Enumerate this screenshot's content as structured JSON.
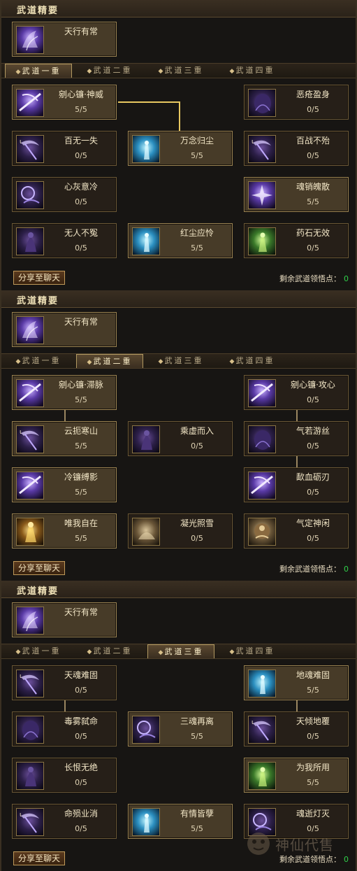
{
  "colors": {
    "accent_gold": "#e8c860",
    "points_green": "#2fd04a",
    "frame": "#6b5836"
  },
  "panels": [
    {
      "section_title": "武道精要",
      "essential": {
        "name": "天行有常",
        "icon": "ghost-dancer-icon"
      },
      "tabs": [
        "武道一重",
        "武道二重",
        "武道三重",
        "武道四重"
      ],
      "active_tab": 0,
      "share_label": "分享至聊天",
      "remaining_label": "剩余武道领悟点：",
      "remaining_value": "0",
      "skills": [
        {
          "name": "剜心镰·神威",
          "points": "5/5",
          "icon": "sickle-slash-icon"
        },
        {
          "name": "恶疮盈身",
          "points": "0/5",
          "icon": "poison-figure-icon"
        },
        {
          "name": "百无一失",
          "points": "0/5",
          "icon": "sickle-icon"
        },
        {
          "name": "万念归尘",
          "points": "5/5",
          "icon": "spirit-blue-icon"
        },
        {
          "name": "百战不殆",
          "points": "0/5",
          "icon": "sickle-icon"
        },
        {
          "name": "心灰意冷",
          "points": "0/5",
          "icon": "dark-orb-icon"
        },
        {
          "name": "魂销魄散",
          "points": "5/5",
          "icon": "soul-burst-icon"
        },
        {
          "name": "无人不冤",
          "points": "0/5",
          "icon": "shadow-figure-icon"
        },
        {
          "name": "红尘应怜",
          "points": "5/5",
          "icon": "spirit-blue-icon"
        },
        {
          "name": "药石无效",
          "points": "0/5",
          "icon": "green-figure-icon"
        }
      ]
    },
    {
      "section_title": "武道精要",
      "essential": {
        "name": "天行有常",
        "icon": "ghost-dancer-icon"
      },
      "tabs": [
        "武道一重",
        "武道二重",
        "武道三重",
        "武道四重"
      ],
      "active_tab": 1,
      "share_label": "分享至聊天",
      "remaining_label": "剩余武道领悟点：",
      "remaining_value": "0",
      "skills": [
        {
          "name": "剜心镰·滞脉",
          "points": "5/5",
          "icon": "sickle-slash-icon"
        },
        {
          "name": "剜心镰·攻心",
          "points": "0/5",
          "icon": "sickle-slash-icon"
        },
        {
          "name": "云扼寒山",
          "points": "5/5",
          "icon": "sickle-icon"
        },
        {
          "name": "乘虚而入",
          "points": "0/5",
          "icon": "shadow-figure-icon"
        },
        {
          "name": "气若游丝",
          "points": "0/5",
          "icon": "poison-figure-icon"
        },
        {
          "name": "冷镰缚影",
          "points": "5/5",
          "icon": "sickle-slash-icon"
        },
        {
          "name": "歃血砺刃",
          "points": "0/5",
          "icon": "sickle-slash-icon"
        },
        {
          "name": "唯我自在",
          "points": "5/5",
          "icon": "golden-figure-icon"
        },
        {
          "name": "凝光照雪",
          "points": "0/5",
          "icon": "sand-figure-icon"
        },
        {
          "name": "气定神闲",
          "points": "0/5",
          "icon": "meditation-icon"
        }
      ]
    },
    {
      "section_title": "武道精要",
      "essential": {
        "name": "天行有常",
        "icon": "ghost-dancer-icon"
      },
      "tabs": [
        "武道一重",
        "武道二重",
        "武道三重",
        "武道四重"
      ],
      "active_tab": 2,
      "share_label": "分享至聊天",
      "remaining_label": "剩余武道领悟点：",
      "remaining_value": "0",
      "skills": [
        {
          "name": "天魂难固",
          "points": "0/5",
          "icon": "sickle-icon"
        },
        {
          "name": "地魂难固",
          "points": "5/5",
          "icon": "spirit-blue-icon"
        },
        {
          "name": "毒雾弑命",
          "points": "0/5",
          "icon": "poison-figure-icon"
        },
        {
          "name": "三魂再离",
          "points": "5/5",
          "icon": "dark-orb-icon"
        },
        {
          "name": "天倾地覆",
          "points": "0/5",
          "icon": "sickle-icon"
        },
        {
          "name": "长恨无绝",
          "points": "0/5",
          "icon": "shadow-figure-icon"
        },
        {
          "name": "为我所用",
          "points": "5/5",
          "icon": "green-figure-icon"
        },
        {
          "name": "命殒业消",
          "points": "0/5",
          "icon": "sickle-icon"
        },
        {
          "name": "有情皆孽",
          "points": "5/5",
          "icon": "spirit-blue-icon"
        },
        {
          "name": "魂逝灯灭",
          "points": "0/5",
          "icon": "dark-orb-icon"
        }
      ]
    }
  ],
  "watermark": "神仙代售"
}
